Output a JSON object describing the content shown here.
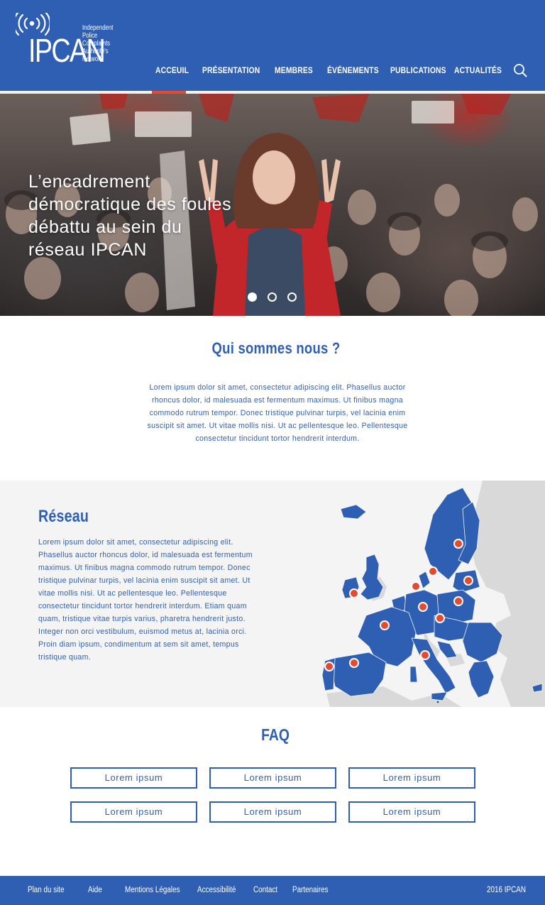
{
  "header": {
    "logo": {
      "word": "IPCAN",
      "tagline": [
        "Independent",
        "Police",
        "Complaints",
        "Authorite's",
        "Network"
      ]
    },
    "nav": [
      {
        "label": "ACCEUIL",
        "active": true
      },
      {
        "label": "PRÉSENTATION",
        "active": false
      },
      {
        "label": "MEMBRES",
        "active": false
      },
      {
        "label": "ÉVÉNEMENTS",
        "active": false
      },
      {
        "label": "PUBLICATIONS",
        "active": false
      },
      {
        "label": "ACTUALITÉS",
        "active": false
      }
    ],
    "search_icon": "search-icon",
    "accent_color": "#e24a33",
    "brand_color": "#2f5fb3"
  },
  "hero": {
    "title": "L’encadrement démocratique des foules débattu au sein du réseau IPCAN",
    "slides": 3,
    "active_slide": 1
  },
  "about": {
    "title": "Qui sommes nous ?",
    "text": "Lorem ipsum dolor sit amet, consectetur adipiscing elit. Phasellus auctor rhoncus dolor, id malesuada est fermentum maximus. Ut finibus magna commodo rutrum tempor. Donec tristique pulvinar turpis, vel lacinia enim suscipit sit amet. Ut vitae mollis nisi. Ut ac pellentesque leo. Pellentesque consectetur tincidunt tortor hendrerit interdum."
  },
  "network": {
    "title": "Réseau",
    "text": "Lorem ipsum dolor sit amet, consectetur adipiscing elit. Phasellus auctor rhoncus dolor, id malesuada est fermentum maximus. Ut finibus magna commodo rutrum tempor. Donec tristique pulvinar turpis, vel lacinia enim suscipit sit amet. Ut vitae mollis nisi. Ut ac pellentesque leo. Pellentesque consectetur tincidunt tortor hendrerit interdum. Etiam quam quam, tristique vitae turpis varius, pharetra hendrerit justo. Integer non orci vestibulum, euismod metus at, lacinia orci. Proin diam ipsum, condimentum at sem sit amet, tempus tristique quam.",
    "map_marker_color": "#e24a33"
  },
  "faq": {
    "title": "FAQ",
    "items": [
      "Lorem ipsum",
      "Lorem ipsum",
      "Lorem ipsum",
      "Lorem ipsum",
      "Lorem ipsum",
      "Lorem ipsum"
    ]
  },
  "footer": {
    "links": [
      "Plan du site",
      "Aide",
      "Mentions Légales",
      "Accessibilité",
      "Contact",
      "Partenaires"
    ],
    "copyright": "2016 IPCAN"
  }
}
